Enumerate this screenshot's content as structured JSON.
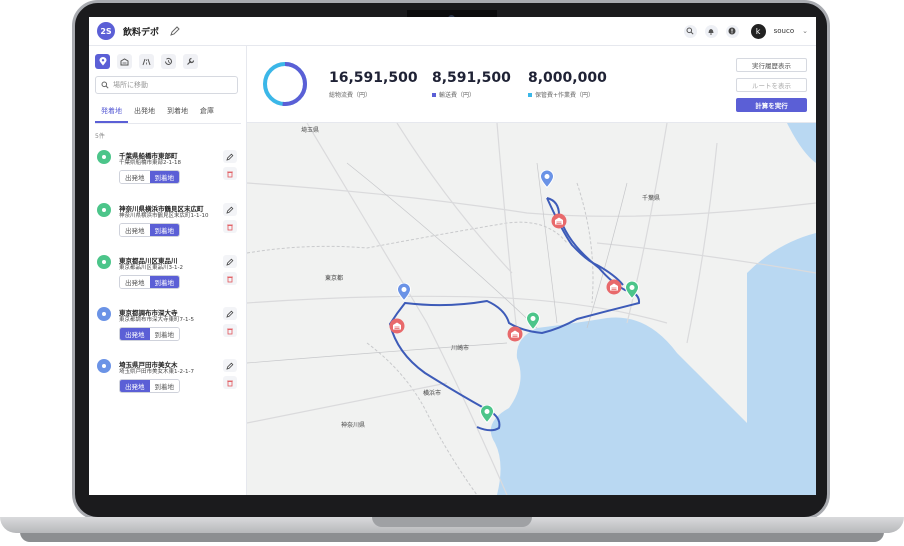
{
  "header": {
    "logo": "2S",
    "project_name": "飲料デポ",
    "username": "souco",
    "avatar_letter": "k"
  },
  "sidebar": {
    "search_placeholder": "場所に移動",
    "tabs": [
      "発着地",
      "出発地",
      "到着地",
      "倉庫"
    ],
    "count": "5件",
    "items": [
      {
        "title": "千葉県船橋市東部町",
        "sub": "千葉県船橋市東部2-1-18",
        "pin": "green",
        "origin_label": "出発地",
        "dest_label": "到着地",
        "selected": "dest"
      },
      {
        "title": "神奈川県横浜市鶴見区末広町",
        "sub": "神奈川県横浜市鶴見区末広町1-1-10",
        "pin": "green",
        "origin_label": "出発地",
        "dest_label": "到着地",
        "selected": "dest"
      },
      {
        "title": "東京都品川区東品川",
        "sub": "東京都品川区東品川3-1-2",
        "pin": "green",
        "origin_label": "出発地",
        "dest_label": "到着地",
        "selected": "dest"
      },
      {
        "title": "東京都調布市深大寺",
        "sub": "東京都調布市深大寺東町7-1-5",
        "pin": "blue",
        "origin_label": "出発地",
        "dest_label": "到着地",
        "selected": "origin"
      },
      {
        "title": "埼玉県戸田市美女木",
        "sub": "埼玉県戸田市美女木東1-2-1-7",
        "pin": "blue",
        "origin_label": "出発地",
        "dest_label": "到着地",
        "selected": "origin"
      }
    ]
  },
  "summary": {
    "total_value": "16,591,500",
    "total_label": "総物流費（円）",
    "transport_value": "8,591,500",
    "transport_label": "輸送費（円）",
    "storage_value": "8,000,000",
    "storage_label": "保管費+作業費（円）",
    "transport_color": "#5b5fd6",
    "storage_color": "#3bb7e8",
    "transport_share": 0.518
  },
  "buttons": {
    "history": "実行履歴表示",
    "route": "ルートを表示",
    "run": "計算を実行"
  },
  "map": {
    "labels": {
      "saitama": "埼玉県",
      "tokyo": "東京都",
      "kanagawa": "神奈川県",
      "chiba": "千葉県",
      "yokohama": "横浜市",
      "kawasaki": "川崎市"
    }
  },
  "colors": {
    "accent": "#5b5fd6",
    "origin_pin": "#6b93e6",
    "dest_pin": "#4cc58a",
    "warehouse": "#e8696b",
    "route": "#3d5bb8",
    "water": "#b9d8f2"
  }
}
